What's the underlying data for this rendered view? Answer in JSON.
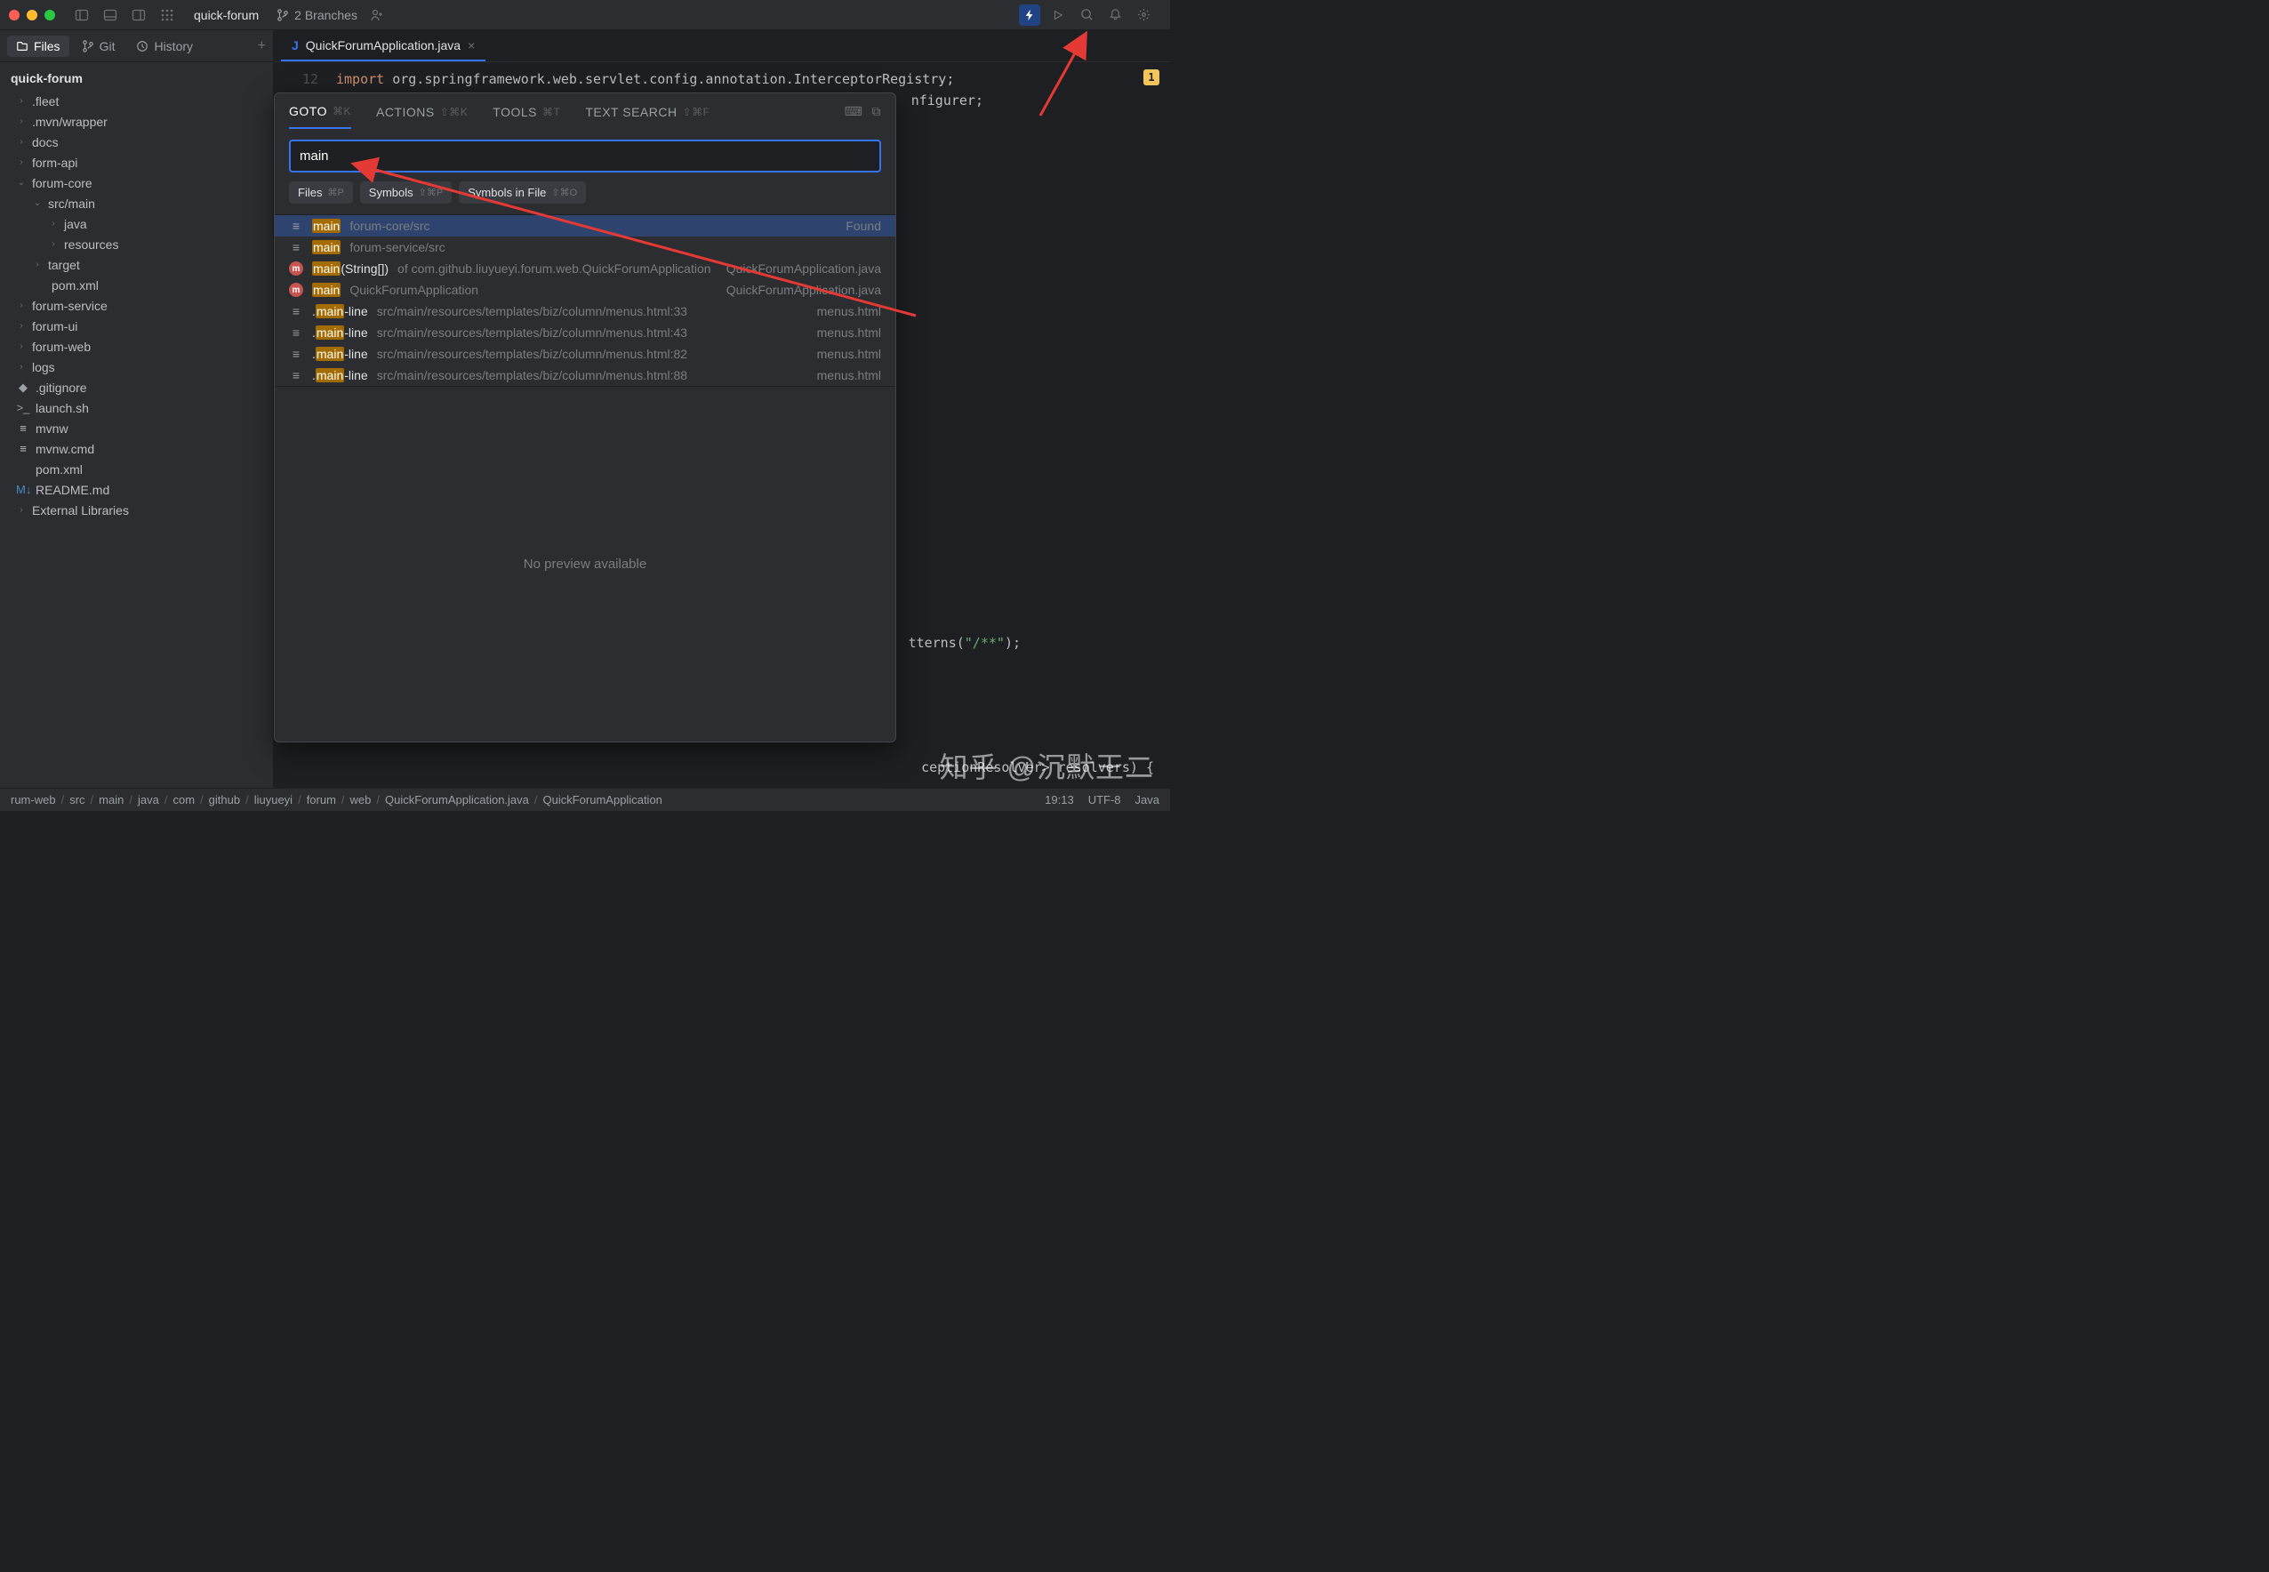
{
  "titlebar": {
    "project": "quick-forum",
    "branches": "2 Branches"
  },
  "sidebar": {
    "tab_files": "Files",
    "tab_git": "Git",
    "tab_history": "History",
    "project_root": "quick-forum",
    "nodes": [
      {
        "name": ".fleet",
        "kind": "folder",
        "depth": 1,
        "expanded": false
      },
      {
        "name": ".mvn/wrapper",
        "kind": "folder",
        "depth": 1,
        "expanded": false
      },
      {
        "name": "docs",
        "kind": "folder",
        "depth": 1,
        "expanded": false
      },
      {
        "name": "form-api",
        "kind": "folder",
        "depth": 1,
        "expanded": false
      },
      {
        "name": "forum-core",
        "kind": "folder",
        "depth": 1,
        "expanded": true
      },
      {
        "name": "src/main",
        "kind": "folder",
        "depth": 2,
        "expanded": true
      },
      {
        "name": "java",
        "kind": "folder",
        "depth": 3,
        "expanded": false
      },
      {
        "name": "resources",
        "kind": "folder",
        "depth": 3,
        "expanded": false
      },
      {
        "name": "target",
        "kind": "folder",
        "depth": 2,
        "expanded": false
      },
      {
        "name": "pom.xml",
        "kind": "xml",
        "depth": 2,
        "leaf": true
      },
      {
        "name": "forum-service",
        "kind": "folder",
        "depth": 1,
        "expanded": false
      },
      {
        "name": "forum-ui",
        "kind": "folder",
        "depth": 1,
        "expanded": false
      },
      {
        "name": "forum-web",
        "kind": "folder",
        "depth": 1,
        "expanded": false
      },
      {
        "name": "logs",
        "kind": "folder",
        "depth": 1,
        "expanded": false
      },
      {
        "name": ".gitignore",
        "kind": "git",
        "depth": 1,
        "leaf": true
      },
      {
        "name": "launch.sh",
        "kind": "sh",
        "depth": 1,
        "leaf": true
      },
      {
        "name": "mvnw",
        "kind": "file",
        "depth": 1,
        "leaf": true
      },
      {
        "name": "mvnw.cmd",
        "kind": "file",
        "depth": 1,
        "leaf": true
      },
      {
        "name": "pom.xml",
        "kind": "xml",
        "depth": 1,
        "leaf": true
      },
      {
        "name": "README.md",
        "kind": "md",
        "depth": 1,
        "leaf": true
      },
      {
        "name": "External Libraries",
        "kind": "folder",
        "depth": 1,
        "expanded": false
      }
    ]
  },
  "tab": {
    "filename": "QuickForumApplication.java",
    "icon": "J"
  },
  "code": {
    "line_no": "12",
    "kw": "import",
    "pkg": " org.springframework.web.servlet.config.annotation.InterceptorRegistry;",
    "tail1": "nfigurer;",
    "tail2": "tterns(",
    "tail2s": "\"/**\"",
    "tail2e": ");",
    "tail3": "ceptionResolver> resolvers) {"
  },
  "gutter_badge": "1",
  "goto": {
    "tabs": [
      {
        "label": "GOTO",
        "hint": "⌘K",
        "active": true
      },
      {
        "label": "ACTIONS",
        "hint": "⇧⌘K"
      },
      {
        "label": "TOOLS",
        "hint": "⌘T"
      },
      {
        "label": "TEXT SEARCH",
        "hint": "⇧⌘F"
      }
    ],
    "input_value": "main",
    "chips": [
      {
        "label": "Files",
        "hint": "⌘P"
      },
      {
        "label": "Symbols",
        "hint": "⇧⌘P"
      },
      {
        "label": "Symbols in File",
        "hint": "⇧⌘O"
      }
    ],
    "results": [
      {
        "icon": "≡",
        "hl": "main",
        "main": "",
        "sub": " forum-core/src",
        "right": "Found",
        "sel": true
      },
      {
        "icon": "≡",
        "hl": "main",
        "main": "",
        "sub": " forum-service/src",
        "right": ""
      },
      {
        "icon": "m",
        "hl": "main",
        "main": "(String[])",
        "sub": " of com.github.liuyueyi.forum.web.QuickForumApplication",
        "right": "QuickForumApplication.java"
      },
      {
        "icon": "m",
        "hl": "main",
        "main": "",
        "sub": " QuickForumApplication",
        "right": "QuickForumApplication.java"
      },
      {
        "icon": "≡",
        "pre": ".",
        "hl": "main",
        "main": "-line",
        "sub": " src/main/resources/templates/biz/column/menus.html:33",
        "right": "menus.html"
      },
      {
        "icon": "≡",
        "pre": ".",
        "hl": "main",
        "main": "-line",
        "sub": " src/main/resources/templates/biz/column/menus.html:43",
        "right": "menus.html"
      },
      {
        "icon": "≡",
        "pre": ".",
        "hl": "main",
        "main": "-line",
        "sub": " src/main/resources/templates/biz/column/menus.html:82",
        "right": "menus.html"
      },
      {
        "icon": "≡",
        "pre": ".",
        "hl": "main",
        "main": "-line",
        "sub": " src/main/resources/templates/biz/column/menus.html:88",
        "right": "menus.html"
      }
    ],
    "preview_text": "No preview available"
  },
  "status": {
    "crumbs": [
      "rum-web",
      "src",
      "main",
      "java",
      "com",
      "github",
      "liuyueyi",
      "forum",
      "web",
      "QuickForumApplication.java",
      "QuickForumApplication"
    ],
    "pos": "19:13",
    "enc": "UTF-8",
    "lang": "Java"
  },
  "watermark": "知乎 @沉默王二"
}
